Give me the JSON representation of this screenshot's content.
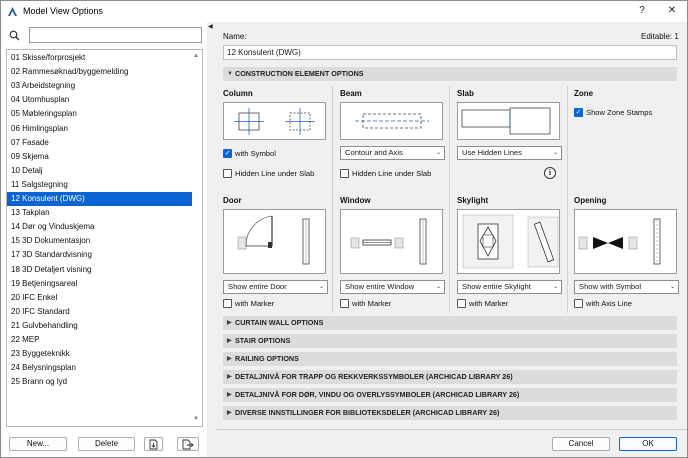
{
  "window": {
    "title": "Model View Options",
    "help_label": "?",
    "close_label": "✕"
  },
  "left": {
    "search_placeholder": "",
    "items": [
      {
        "label": "01 Skisse/forprosjekt",
        "selected": false
      },
      {
        "label": "02 Rammesøknad/byggemelding",
        "selected": false
      },
      {
        "label": "03 Arbeidstegning",
        "selected": false
      },
      {
        "label": "04 Utomhusplan",
        "selected": false
      },
      {
        "label": "05 Møbleringsplan",
        "selected": false
      },
      {
        "label": "06 Himlingsplan",
        "selected": false
      },
      {
        "label": "07 Fasade",
        "selected": false
      },
      {
        "label": "09 Skjema",
        "selected": false
      },
      {
        "label": "10 Detalj",
        "selected": false
      },
      {
        "label": "11 Salgstegning",
        "selected": false
      },
      {
        "label": "12 Konsulent (DWG)",
        "selected": true
      },
      {
        "label": "13 Takplan",
        "selected": false
      },
      {
        "label": "14 Dør og Vinduskjema",
        "selected": false
      },
      {
        "label": "15 3D Dokumentasjon",
        "selected": false
      },
      {
        "label": "17 3D Standardvisning",
        "selected": false
      },
      {
        "label": "18 3D Detaljert visning",
        "selected": false
      },
      {
        "label": "19 Betjeningsareal",
        "selected": false
      },
      {
        "label": "20 IFC Enkel",
        "selected": false
      },
      {
        "label": "20 IFC Standard",
        "selected": false
      },
      {
        "label": "21 Gulvbehandling",
        "selected": false
      },
      {
        "label": "22 MEP",
        "selected": false
      },
      {
        "label": "23 Byggeteknikk",
        "selected": false
      },
      {
        "label": "24 Belysningsplan",
        "selected": false
      },
      {
        "label": "25 Brann og lyd",
        "selected": false
      }
    ],
    "new_label": "New...",
    "delete_label": "Delete"
  },
  "right": {
    "name_label": "Name:",
    "editable_label": "Editable: 1",
    "name_value": "12 Konsulent (DWG)",
    "construction_header": "CONSTRUCTION ELEMENT OPTIONS",
    "column": {
      "title": "Column",
      "check1": "with Symbol",
      "check1_on": true,
      "check2": "Hidden Line under Slab",
      "check2_on": false
    },
    "beam": {
      "title": "Beam",
      "dropdown": "Contour and Axis",
      "check": "Hidden Line under Slab",
      "check_on": false
    },
    "slab": {
      "title": "Slab",
      "dropdown": "Use Hidden Lines",
      "info": "i"
    },
    "zone": {
      "title": "Zone",
      "check": "Show Zone Stamps",
      "check_on": true
    },
    "door": {
      "title": "Door",
      "dropdown": "Show entire Door",
      "check": "with Marker",
      "check_on": false
    },
    "window": {
      "title": "Window",
      "dropdown": "Show entire Window",
      "check": "with Marker",
      "check_on": false
    },
    "skylight": {
      "title": "Skylight",
      "dropdown": "Show entire Skylight",
      "check": "with Marker",
      "check_on": false
    },
    "opening": {
      "title": "Opening",
      "dropdown": "Show with Symbol",
      "check": "with Axis Line",
      "check_on": false
    },
    "collapsed_sections": [
      "CURTAIN WALL OPTIONS",
      "STAIR OPTIONS",
      "RAILING OPTIONS",
      "DETALJNIVÅ FOR TRAPP OG REKKVERKSSYMBOLER (ARCHICAD LIBRARY 26)",
      "DETALJNIVÅ FOR DØR, VINDU OG OVERLYSSYMBOLER (ARCHICAD LIBRARY 26)",
      "DIVERSE INNSTILLINGER FOR BIBLIOTEKSDELER (ARCHICAD LIBRARY 26)"
    ],
    "cancel_label": "Cancel",
    "ok_label": "OK"
  },
  "colors": {
    "accent": "#0a64d6",
    "section_bg": "#dcdcdc"
  }
}
